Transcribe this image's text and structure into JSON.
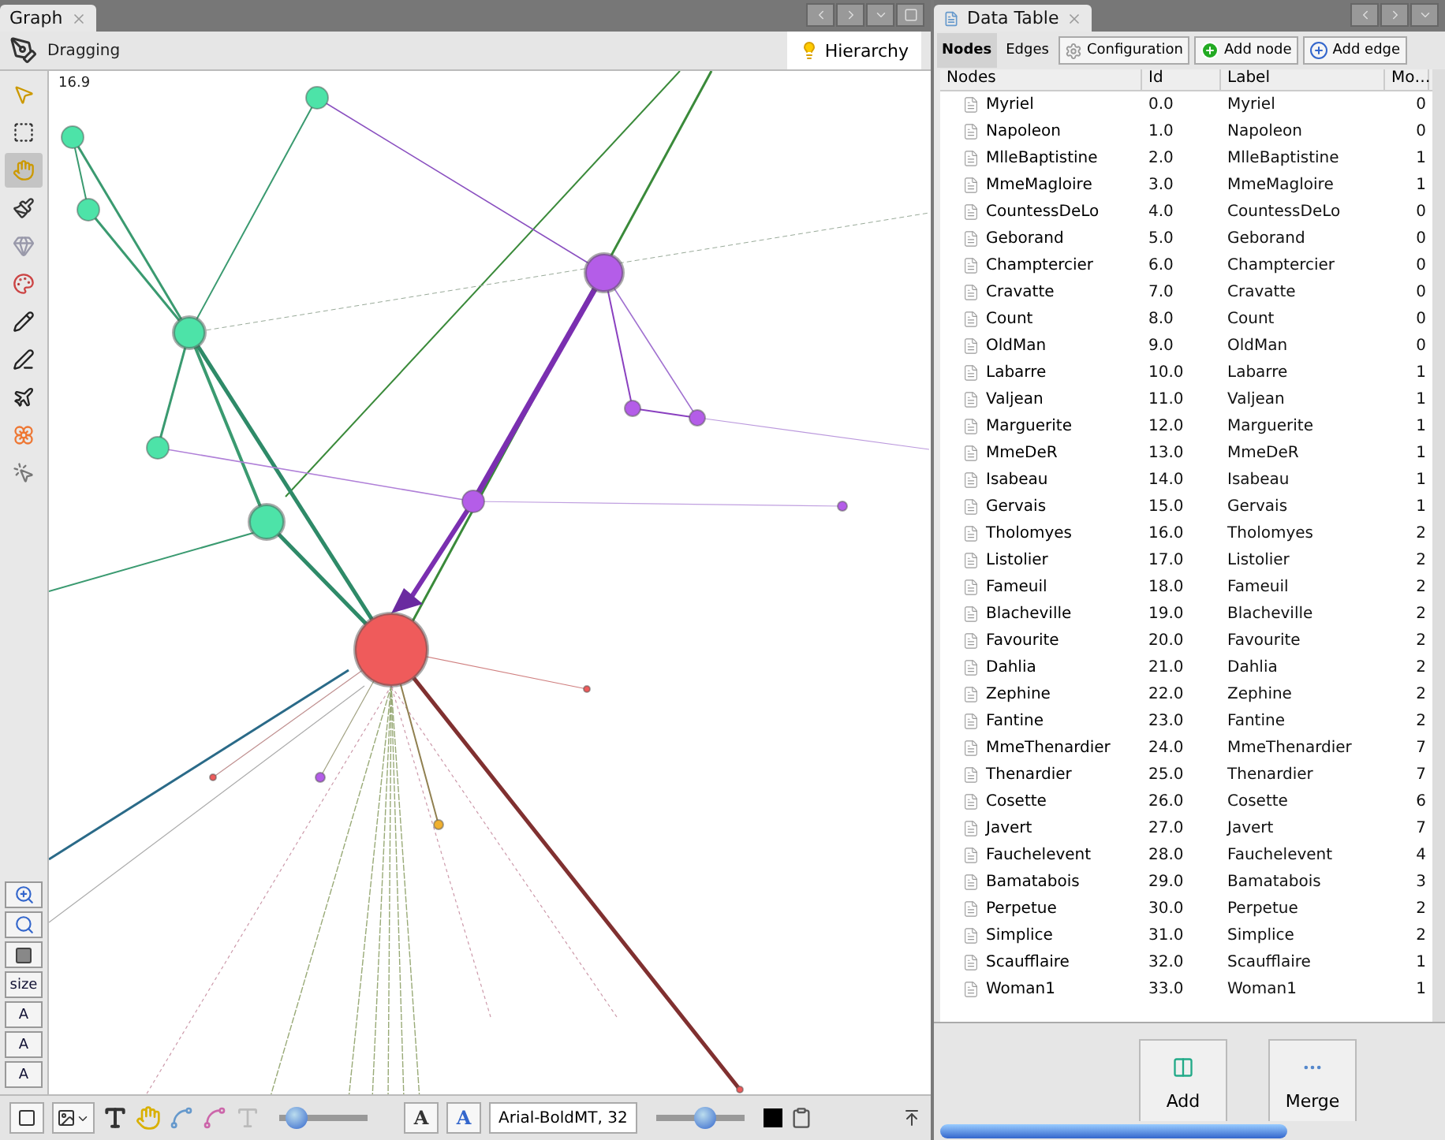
{
  "graph_window": {
    "tab": "Graph",
    "mode": "Dragging",
    "hierarchy_button": "Hierarchy",
    "zoom_label": "16.9",
    "tools": [
      {
        "kind": "pointer",
        "selected": false
      },
      {
        "kind": "rect-select",
        "selected": false
      },
      {
        "kind": "drag",
        "selected": true
      },
      {
        "kind": "brush",
        "selected": false
      },
      {
        "kind": "gem",
        "selected": false
      },
      {
        "kind": "palette",
        "selected": false
      },
      {
        "kind": "pencil",
        "selected": false
      },
      {
        "kind": "pen",
        "selected": false
      },
      {
        "kind": "plane",
        "selected": false
      },
      {
        "kind": "flower",
        "selected": false
      },
      {
        "kind": "pointer-help",
        "selected": false
      }
    ],
    "side_buttons": [
      {
        "kind": "zoom-fit"
      },
      {
        "kind": "zoom-reset"
      },
      {
        "kind": "frame"
      },
      {
        "kind": "text",
        "label": "size"
      },
      {
        "kind": "text",
        "label": "A"
      },
      {
        "kind": "text",
        "label": "A"
      },
      {
        "kind": "text",
        "label": "A"
      }
    ],
    "font_buttons": [
      "A",
      "A"
    ],
    "font_field": "Arial-BoldMT, 32",
    "sliders": [
      {
        "level": 0.2
      },
      {
        "level": 0.55
      }
    ]
  },
  "data_table": {
    "tab": "Data Table",
    "tabs": [
      {
        "label": "Nodes",
        "selected": true
      },
      {
        "label": "Edges",
        "selected": false
      }
    ],
    "buttons": [
      {
        "kind": "config",
        "label": "Configuration"
      },
      {
        "kind": "add-node",
        "label": "Add node"
      },
      {
        "kind": "add-edge",
        "label": "Add edge"
      }
    ],
    "columns": [
      "Nodes",
      "Id",
      "Label",
      "Mo…"
    ],
    "rows": [
      {
        "node": "Myriel",
        "id": "0.0",
        "label": "Myriel",
        "mo": "0"
      },
      {
        "node": "Napoleon",
        "id": "1.0",
        "label": "Napoleon",
        "mo": "0"
      },
      {
        "node": "MlleBaptistine",
        "id": "2.0",
        "label": "MlleBaptistine",
        "mo": "1"
      },
      {
        "node": "MmeMagloire",
        "id": "3.0",
        "label": "MmeMagloire",
        "mo": "1"
      },
      {
        "node": "CountessDeLo",
        "id": "4.0",
        "label": "CountessDeLo",
        "mo": "0"
      },
      {
        "node": "Geborand",
        "id": "5.0",
        "label": "Geborand",
        "mo": "0"
      },
      {
        "node": "Champtercier",
        "id": "6.0",
        "label": "Champtercier",
        "mo": "0"
      },
      {
        "node": "Cravatte",
        "id": "7.0",
        "label": "Cravatte",
        "mo": "0"
      },
      {
        "node": "Count",
        "id": "8.0",
        "label": "Count",
        "mo": "0"
      },
      {
        "node": "OldMan",
        "id": "9.0",
        "label": "OldMan",
        "mo": "0"
      },
      {
        "node": "Labarre",
        "id": "10.0",
        "label": "Labarre",
        "mo": "1"
      },
      {
        "node": "Valjean",
        "id": "11.0",
        "label": "Valjean",
        "mo": "1"
      },
      {
        "node": "Marguerite",
        "id": "12.0",
        "label": "Marguerite",
        "mo": "1"
      },
      {
        "node": "MmeDeR",
        "id": "13.0",
        "label": "MmeDeR",
        "mo": "1"
      },
      {
        "node": "Isabeau",
        "id": "14.0",
        "label": "Isabeau",
        "mo": "1"
      },
      {
        "node": "Gervais",
        "id": "15.0",
        "label": "Gervais",
        "mo": "1"
      },
      {
        "node": "Tholomyes",
        "id": "16.0",
        "label": "Tholomyes",
        "mo": "2"
      },
      {
        "node": "Listolier",
        "id": "17.0",
        "label": "Listolier",
        "mo": "2"
      },
      {
        "node": "Fameuil",
        "id": "18.0",
        "label": "Fameuil",
        "mo": "2"
      },
      {
        "node": "Blacheville",
        "id": "19.0",
        "label": "Blacheville",
        "mo": "2"
      },
      {
        "node": "Favourite",
        "id": "20.0",
        "label": "Favourite",
        "mo": "2"
      },
      {
        "node": "Dahlia",
        "id": "21.0",
        "label": "Dahlia",
        "mo": "2"
      },
      {
        "node": "Zephine",
        "id": "22.0",
        "label": "Zephine",
        "mo": "2"
      },
      {
        "node": "Fantine",
        "id": "23.0",
        "label": "Fantine",
        "mo": "2"
      },
      {
        "node": "MmeThenardier",
        "id": "24.0",
        "label": "MmeThenardier",
        "mo": "7"
      },
      {
        "node": "Thenardier",
        "id": "25.0",
        "label": "Thenardier",
        "mo": "7"
      },
      {
        "node": "Cosette",
        "id": "26.0",
        "label": "Cosette",
        "mo": "6"
      },
      {
        "node": "Javert",
        "id": "27.0",
        "label": "Javert",
        "mo": "7"
      },
      {
        "node": "Fauchelevent",
        "id": "28.0",
        "label": "Fauchelevent",
        "mo": "4"
      },
      {
        "node": "Bamatabois",
        "id": "29.0",
        "label": "Bamatabois",
        "mo": "3"
      },
      {
        "node": "Perpetue",
        "id": "30.0",
        "label": "Perpetue",
        "mo": "2"
      },
      {
        "node": "Simplice",
        "id": "31.0",
        "label": "Simplice",
        "mo": "2"
      },
      {
        "node": "Scaufflaire",
        "id": "32.0",
        "label": "Scaufflaire",
        "mo": "1"
      },
      {
        "node": "Woman1",
        "id": "33.0",
        "label": "Woman1",
        "mo": "1"
      }
    ],
    "actions": [
      {
        "kind": "add",
        "label": "Add"
      },
      {
        "kind": "merge",
        "label": "Merge"
      }
    ]
  }
}
